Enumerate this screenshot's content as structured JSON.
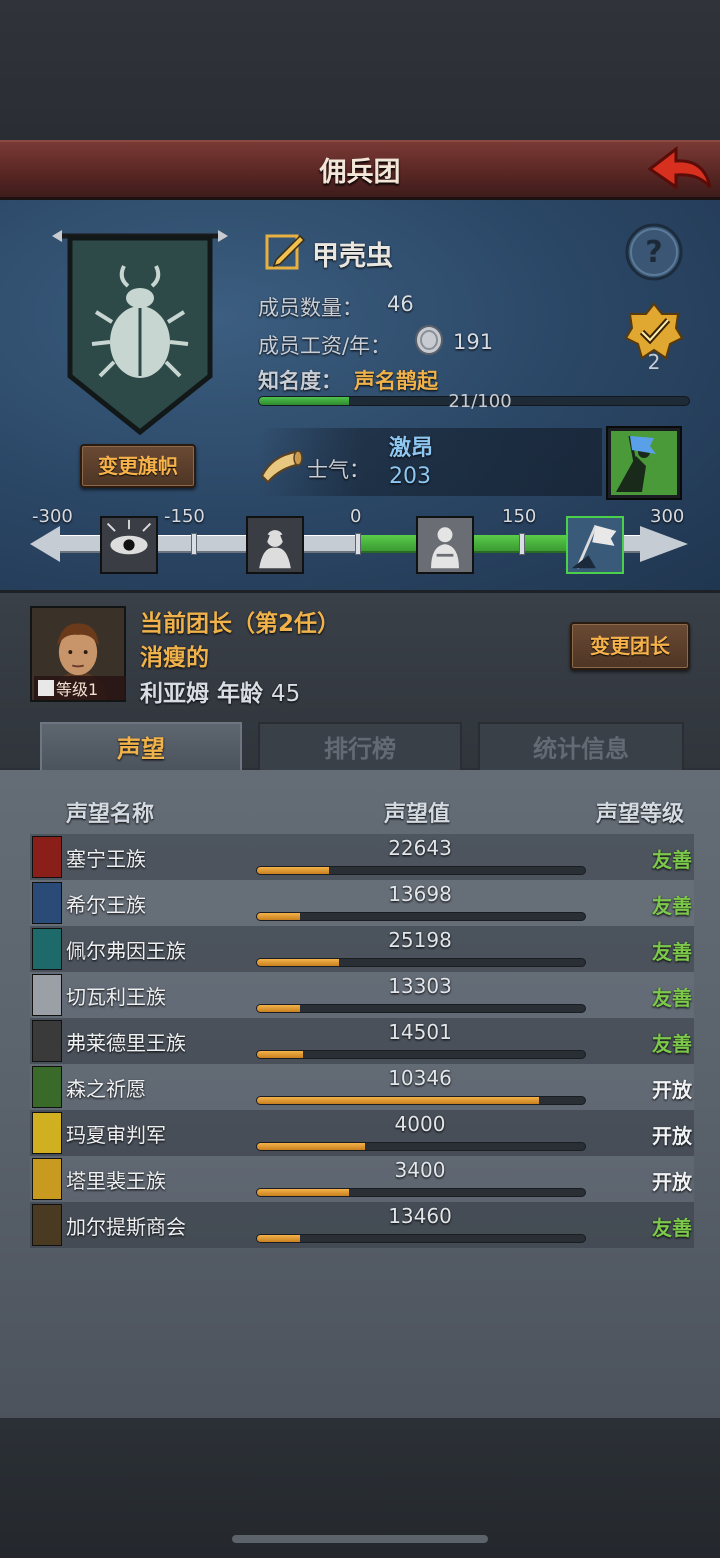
{
  "title": "佣兵团",
  "guild": {
    "name": "甲壳虫",
    "change_flag": "变更旗帜",
    "members_label": "成员数量：",
    "members_value": "46",
    "wage_label": "成员工资/年：",
    "wage_value": "191",
    "fame_label": "知名度：",
    "fame_value": "声名鹊起",
    "fame_progress": "21/100",
    "fame_fraction": 0.21,
    "badge_count": "2",
    "morale_label": "士气：",
    "morale_status": "激昂",
    "morale_value": "203"
  },
  "morale_scale": {
    "ticks": [
      "-300",
      "-150",
      "0",
      "150",
      "300"
    ]
  },
  "leader": {
    "title": "当前团长（第2任）",
    "trait": "消瘦的",
    "name_line": "利亚姆  年龄",
    "age": "45",
    "level": "等级1",
    "change_leader": "变更团长"
  },
  "tabs": [
    "声望",
    "排行榜",
    "统计信息"
  ],
  "columns": {
    "name": "声望名称",
    "value": "声望值",
    "level": "声望等级"
  },
  "reputation": [
    {
      "name": "塞宁王族",
      "value": "22643",
      "fill": 0.22,
      "level": "友善",
      "color": "#7cc84a",
      "icon_bg": "#8a1e18"
    },
    {
      "name": "希尔王族",
      "value": "13698",
      "fill": 0.13,
      "level": "友善",
      "color": "#7cc84a",
      "icon_bg": "#2a4a78"
    },
    {
      "name": "佩尔弗因王族",
      "value": "25198",
      "fill": 0.25,
      "level": "友善",
      "color": "#7cc84a",
      "icon_bg": "#1e6a6a"
    },
    {
      "name": "切瓦利王族",
      "value": "13303",
      "fill": 0.13,
      "level": "友善",
      "color": "#7cc84a",
      "icon_bg": "#9aa0a6"
    },
    {
      "name": "弗莱德里王族",
      "value": "14501",
      "fill": 0.14,
      "level": "友善",
      "color": "#7cc84a",
      "icon_bg": "#3a3a3a"
    },
    {
      "name": "森之祈愿",
      "value": "10346",
      "fill": 0.86,
      "level": "开放",
      "color": "#f0f2f4",
      "icon_bg": "#3a6a2a"
    },
    {
      "name": "玛夏审判军",
      "value": "4000",
      "fill": 0.33,
      "level": "开放",
      "color": "#f0f2f4",
      "icon_bg": "#d0b020"
    },
    {
      "name": "塔里裴王族",
      "value": "3400",
      "fill": 0.28,
      "level": "开放",
      "color": "#f0f2f4",
      "icon_bg": "#c89a20"
    },
    {
      "name": "加尔提斯商会",
      "value": "13460",
      "fill": 0.13,
      "level": "友善",
      "color": "#7cc84a",
      "icon_bg": "#4a3a22"
    }
  ]
}
